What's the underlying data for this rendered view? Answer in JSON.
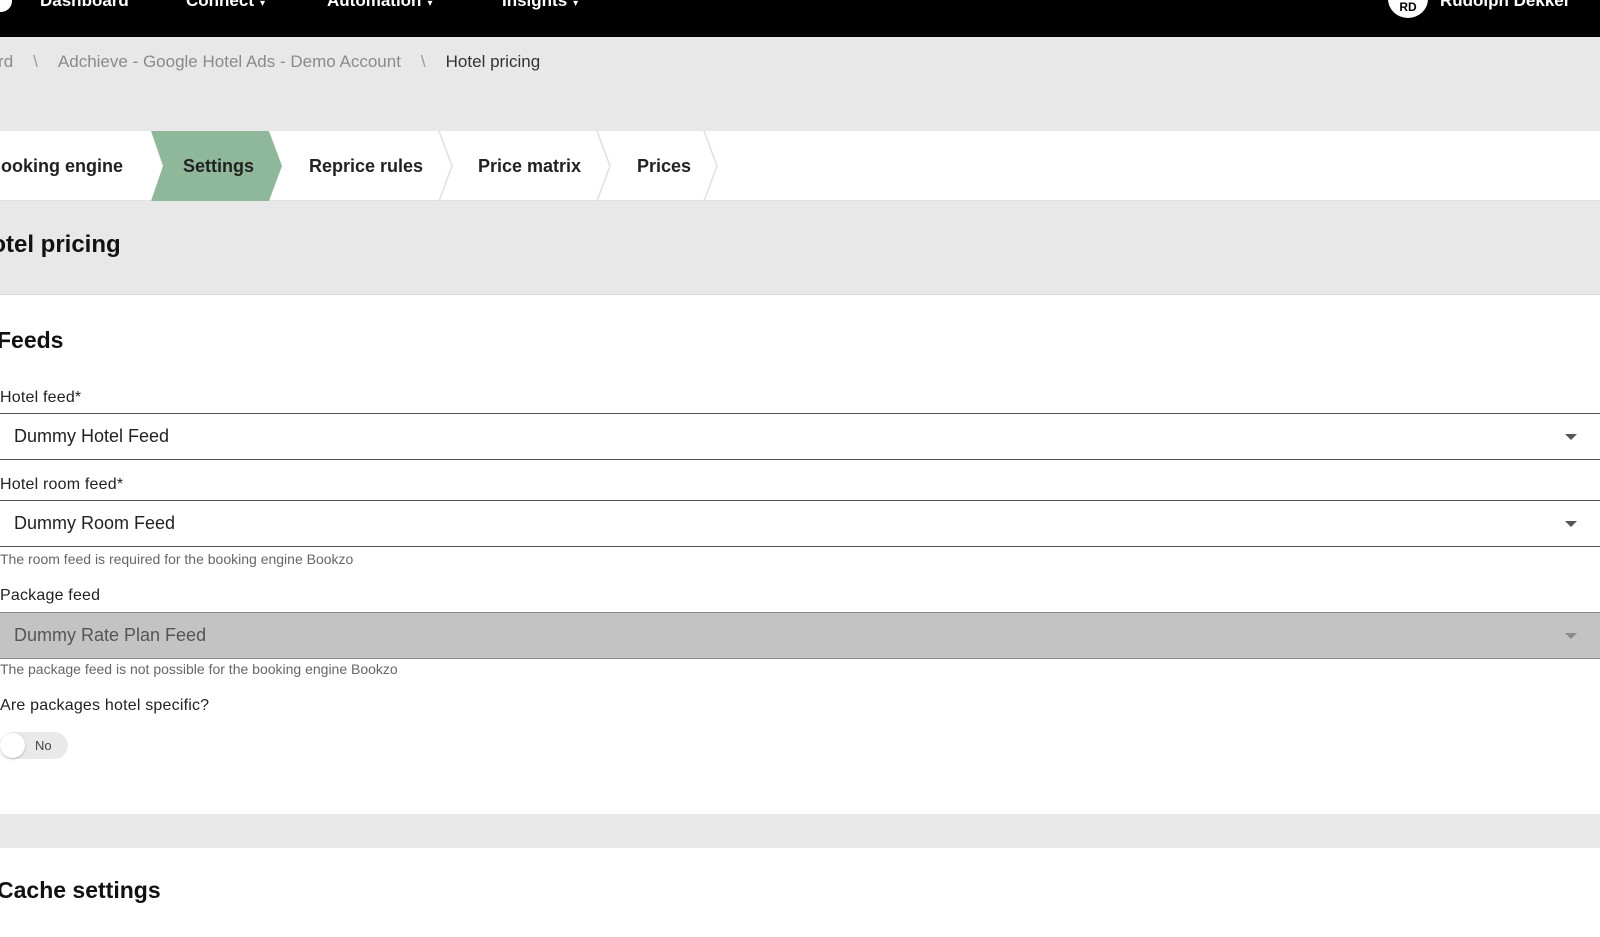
{
  "nav": {
    "items": [
      {
        "label": "Dashboard",
        "dropdown": false
      },
      {
        "label": "Connect",
        "dropdown": true
      },
      {
        "label": "Automation",
        "dropdown": true
      },
      {
        "label": "Insights",
        "dropdown": true
      }
    ],
    "user": {
      "initials": "RD",
      "name": "Rudolph Dekker"
    }
  },
  "breadcrumb": {
    "items": [
      "Dashboard",
      "Adchieve - Google Hotel Ads - Demo Account",
      "Hotel pricing"
    ],
    "separator": "\\"
  },
  "tabs": [
    {
      "label": "Booking engine",
      "active": false
    },
    {
      "label": "Settings",
      "active": true
    },
    {
      "label": "Reprice rules",
      "active": false
    },
    {
      "label": "Price matrix",
      "active": false
    },
    {
      "label": "Prices",
      "active": false
    }
  ],
  "page": {
    "title": "Hotel pricing"
  },
  "feeds": {
    "section_title": "Feeds",
    "hotel_feed": {
      "label": "Hotel feed*",
      "value": "Dummy Hotel Feed"
    },
    "hotel_room_feed": {
      "label": "Hotel room feed*",
      "value": "Dummy Room Feed",
      "hint": "The room feed is required for the booking engine Bookzo"
    },
    "package_feed": {
      "label": "Package feed",
      "value": "Dummy Rate Plan Feed",
      "disabled": true,
      "hint": "The package feed is not possible for the booking engine Bookzo"
    },
    "packages_hotel_specific": {
      "label": "Are packages hotel specific?",
      "toggle_label": "No",
      "on": false
    }
  },
  "cache": {
    "section_title": "Cache settings"
  },
  "colors": {
    "topbar": "#000000",
    "active_tab": "#8fb89a",
    "band": "#e8e8e8",
    "disabled_select": "#c3c3c3"
  }
}
